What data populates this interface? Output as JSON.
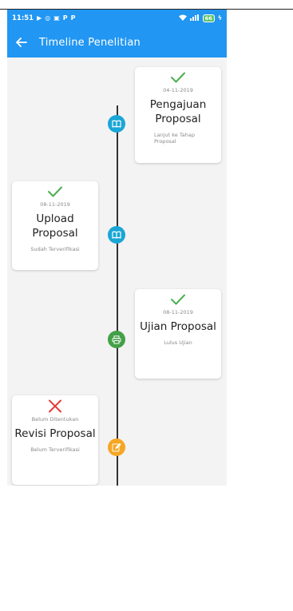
{
  "status_bar": {
    "time": "11:51",
    "left_icons": [
      "play-icon",
      "whatsapp-icon",
      "gallery-icon",
      "p-icon",
      "p-icon"
    ],
    "right_icons": [
      "wifi-icon",
      "signal-icon"
    ],
    "battery": "66"
  },
  "app_bar": {
    "back_icon": "arrow-left-icon",
    "title": "Timeline Penelitian",
    "color": "#2196f3"
  },
  "timeline": [
    {
      "side": "right",
      "state": "check",
      "date": "04-11-2019",
      "name": "Pengajuan Proposal",
      "status": "Lanjut ke Tahap Proposal",
      "node_icon": "book-icon",
      "node_color": "#1aa6d6"
    },
    {
      "side": "left",
      "state": "check",
      "date": "08-11-2019",
      "name": "Upload Proposal",
      "status": "Sudah Terverifikasi",
      "node_icon": "book-icon",
      "node_color": "#1aa6d6"
    },
    {
      "side": "right",
      "state": "check",
      "date": "08-11-2019",
      "name": "Ujian Proposal",
      "status": "Lulus Ujian",
      "node_icon": "printer-icon",
      "node_color": "#43a047"
    },
    {
      "side": "left",
      "state": "cross",
      "date": "Belum Ditentukan",
      "name": "Revisi Proposal",
      "status": "Belum Terverifikasi",
      "node_icon": "edit-icon",
      "node_color": "#f5a623"
    }
  ]
}
